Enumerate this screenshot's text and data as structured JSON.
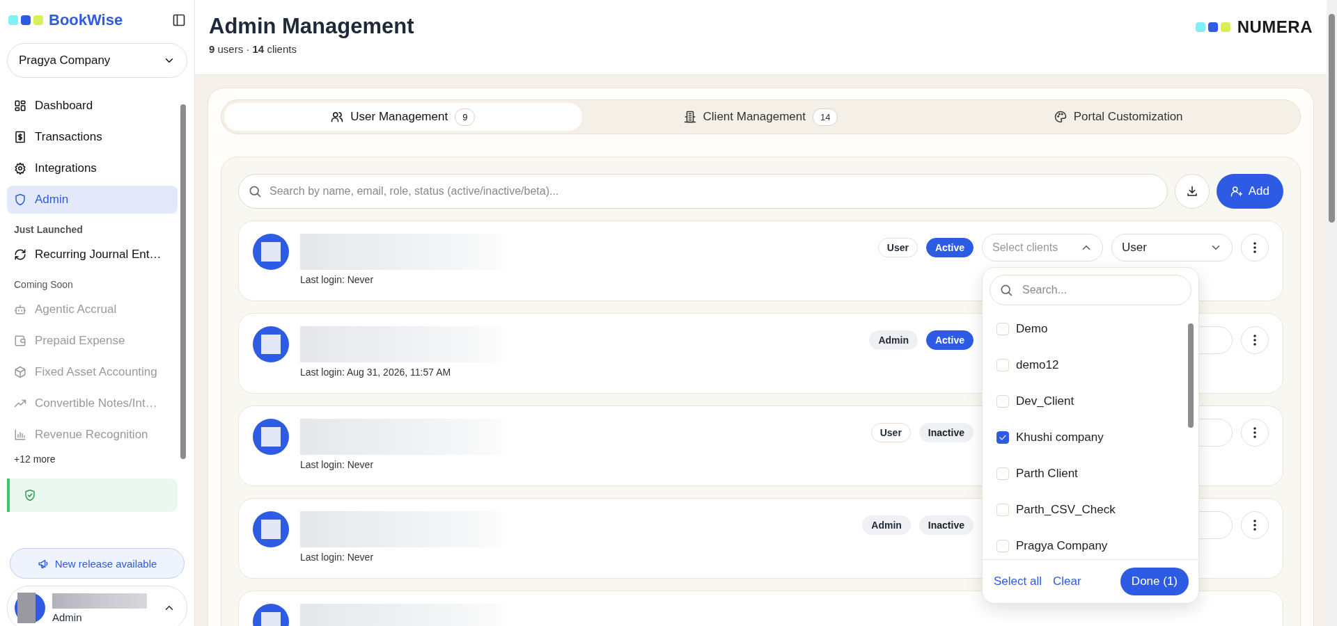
{
  "sidebar": {
    "brand": "BookWise",
    "company_select": "Pragya Company",
    "nav": [
      {
        "label": "Dashboard",
        "selected": false
      },
      {
        "label": "Transactions",
        "selected": false
      },
      {
        "label": "Integrations",
        "selected": false
      },
      {
        "label": "Admin",
        "selected": true
      }
    ],
    "sections": [
      {
        "title": "Just Launched",
        "items": [
          {
            "label": "Recurring Journal Ent…",
            "disabled": false
          }
        ]
      },
      {
        "title": "Coming Soon",
        "items": [
          {
            "label": "Agentic Accrual",
            "disabled": true
          },
          {
            "label": "Prepaid Expense",
            "disabled": true
          },
          {
            "label": "Fixed Asset Accounting",
            "disabled": true
          },
          {
            "label": "Convertible Notes/Int…",
            "disabled": true
          },
          {
            "label": "Revenue Recognition",
            "disabled": true
          }
        ]
      }
    ],
    "more": "+12 more",
    "release_button": "New release available",
    "user": {
      "role": "Admin"
    }
  },
  "header": {
    "title": "Admin Management",
    "subtitle": "**9** users · **14** clients",
    "logo": "NUMERA"
  },
  "tabs": [
    {
      "label": "User Management",
      "count": "9",
      "selected": true
    },
    {
      "label": "Client Management",
      "count": "14",
      "selected": false
    },
    {
      "label": "Portal Customization",
      "selected": false
    }
  ],
  "search": {
    "placeholder": "Search by name, email, role, status (active/inactive/beta)..."
  },
  "add_button": "Add",
  "users": [
    {
      "last_login": "Last login: Never",
      "role_badge": "User",
      "outlined": true,
      "status": "Active",
      "active": true,
      "clients_placeholder": "Select clients",
      "expanded": true,
      "role_select": "User"
    },
    {
      "last_login": "Last login: Aug 31, 2026, 11:57 AM",
      "role_badge": "Admin",
      "outlined": false,
      "status": "Active",
      "active": true
    },
    {
      "last_login": "Last login: Never",
      "role_badge": "User",
      "outlined": true,
      "status": "Inactive",
      "active": false
    },
    {
      "last_login": "Last login: Never",
      "role_badge": "Admin",
      "outlined": false,
      "status": "Inactive",
      "active": false
    }
  ],
  "client_dropdown": {
    "placeholder": "Search...",
    "options": [
      {
        "label": "Demo",
        "checked": false
      },
      {
        "label": "demo12",
        "checked": false
      },
      {
        "label": "Dev_Client",
        "checked": false
      },
      {
        "label": "Khushi company",
        "checked": true
      },
      {
        "label": "Parth Client",
        "checked": false
      },
      {
        "label": "Parth_CSV_Check",
        "checked": false
      },
      {
        "label": "Pragya Company",
        "checked": false
      }
    ],
    "select_all": "Select all",
    "clear": "Clear",
    "done": "Done (1)"
  }
}
